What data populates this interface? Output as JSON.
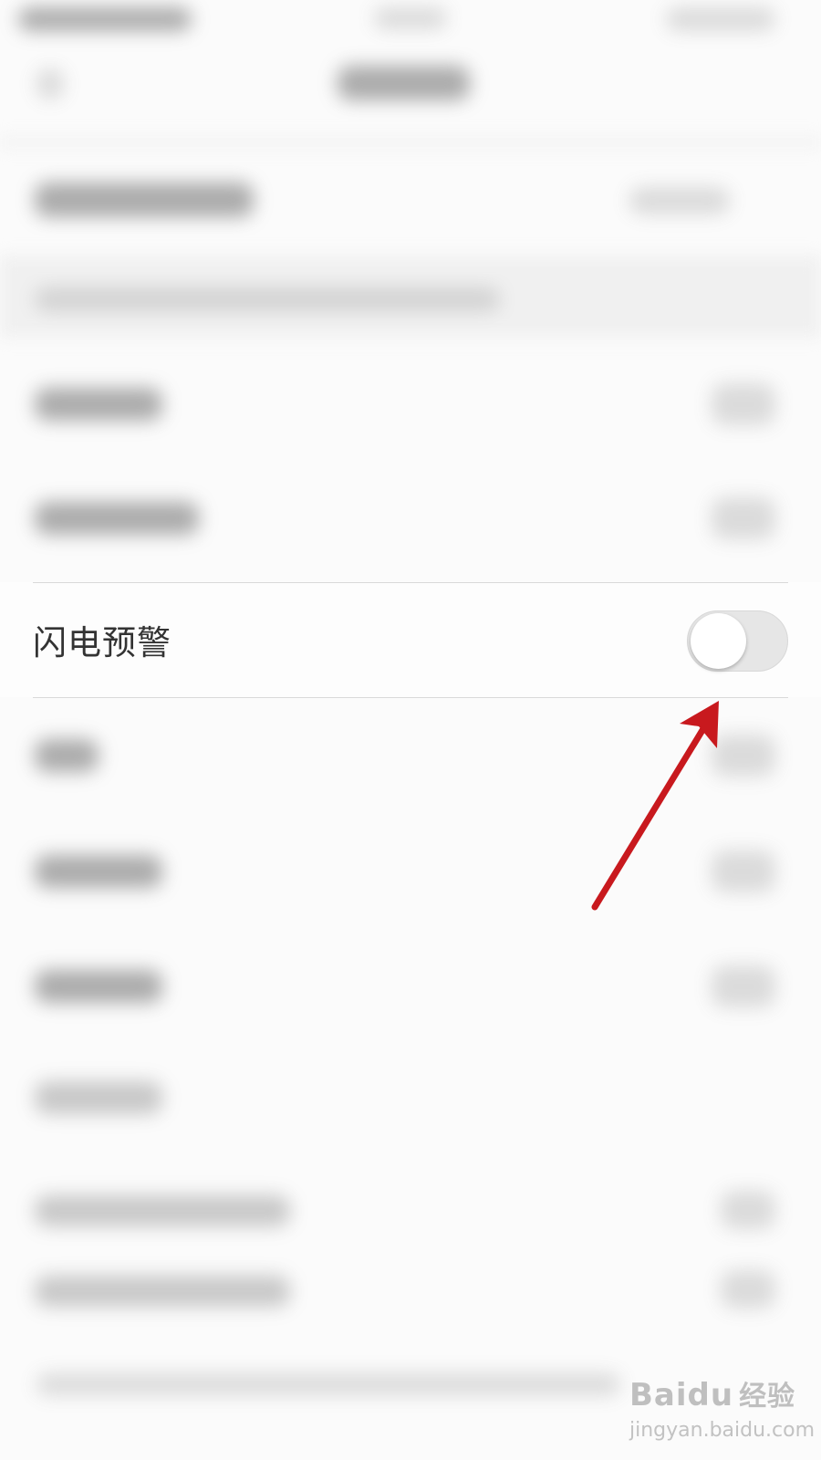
{
  "setting_row": {
    "label": "闪电预警",
    "toggle_on": false
  },
  "watermark": {
    "logo": "Bai",
    "logo_suffix": "du",
    "logo_cn": "经验",
    "url": "jingyan.baidu.com"
  },
  "colors": {
    "annotation_arrow": "#c8191e",
    "toggle_off_track": "#e6e6e6",
    "label_text": "#333333"
  }
}
